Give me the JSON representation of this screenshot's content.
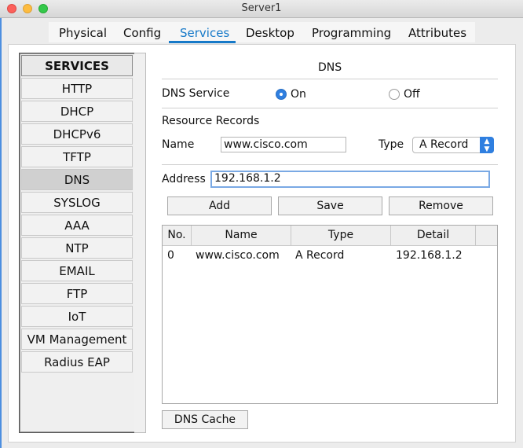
{
  "window": {
    "title": "Server1"
  },
  "tabs": [
    {
      "label": "Physical"
    },
    {
      "label": "Config"
    },
    {
      "label": "Services"
    },
    {
      "label": "Desktop"
    },
    {
      "label": "Programming"
    },
    {
      "label": "Attributes"
    }
  ],
  "active_tab": "Services",
  "sidebar": {
    "header": "SERVICES",
    "items": [
      {
        "label": "HTTP"
      },
      {
        "label": "DHCP"
      },
      {
        "label": "DHCPv6"
      },
      {
        "label": "TFTP"
      },
      {
        "label": "DNS"
      },
      {
        "label": "SYSLOG"
      },
      {
        "label": "AAA"
      },
      {
        "label": "NTP"
      },
      {
        "label": "EMAIL"
      },
      {
        "label": "FTP"
      },
      {
        "label": "IoT"
      },
      {
        "label": "VM Management"
      },
      {
        "label": "Radius EAP"
      }
    ],
    "selected": "DNS"
  },
  "dns": {
    "title": "DNS",
    "service_label": "DNS Service",
    "on_label": "On",
    "off_label": "Off",
    "service_state": "On",
    "resource_records_label": "Resource Records",
    "name_label": "Name",
    "name_value": "www.cisco.com",
    "type_label": "Type",
    "type_value": "A Record",
    "address_label": "Address",
    "address_value": "192.168.1.2",
    "add_button": "Add",
    "save_button": "Save",
    "remove_button": "Remove",
    "table": {
      "columns": [
        "No.",
        "Name",
        "Type",
        "Detail"
      ],
      "rows": [
        [
          "0",
          "www.cisco.com",
          "A Record",
          "192.168.1.2"
        ]
      ]
    },
    "cache_button": "DNS Cache"
  }
}
